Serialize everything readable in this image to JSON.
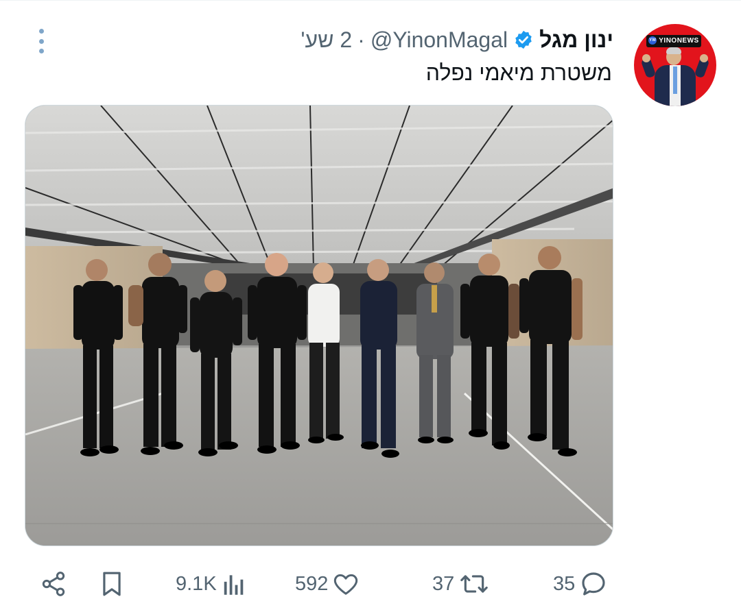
{
  "tweet": {
    "author": {
      "display_name": "ינון מגל",
      "handle": "@YinonMagal",
      "verified": true,
      "avatar_badge_text": "YINONEWS",
      "avatar_badge_mark": "YM",
      "avatar_bg": "#e2141c"
    },
    "separator": "·",
    "time": "2 שע'",
    "text": "משטרת מיאמי נפלה",
    "media": {
      "type": "photo"
    },
    "actions": {
      "share_icon": "share-icon",
      "bookmark_icon": "bookmark-icon",
      "views": "9.1K",
      "views_icon": "views-chart-icon",
      "likes": "592",
      "likes_icon": "heart-icon",
      "retweets": "37",
      "retweets_icon": "retweet-icon",
      "replies": "35",
      "replies_icon": "reply-bubble-icon"
    },
    "colors": {
      "verified": "#1d9bf0",
      "secondary_text": "#536471",
      "more_dots": "#7fa6c9"
    }
  }
}
